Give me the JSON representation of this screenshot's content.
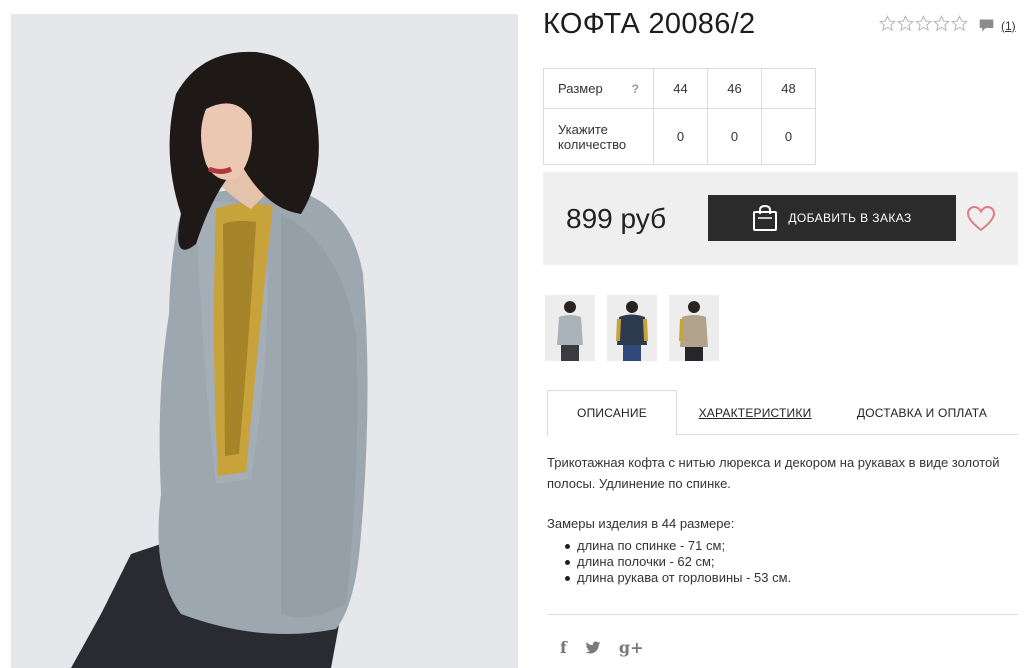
{
  "product": {
    "title": "КОФТА 20086/2",
    "rating_stars": 0,
    "review_count": "(1)"
  },
  "size_table": {
    "size_label": "Размер",
    "help": "?",
    "sizes": [
      "44",
      "46",
      "48"
    ],
    "qty_label": "Укажите количество",
    "quantities": [
      "0",
      "0",
      "0"
    ]
  },
  "purchase": {
    "price": "899 руб",
    "add_button": "ДОБАВИТЬ В ЗАКАЗ"
  },
  "thumbnails": [
    "grey-sweater",
    "navy-sweater",
    "beige-sweater"
  ],
  "tabs": {
    "description": "ОПИСАНИЕ",
    "specs": "ХАРАКТЕРИСТИКИ",
    "delivery": "ДОСТАВКА И ОПЛАТА"
  },
  "description": {
    "text": "Трикотажная кофта с нитью люрекса и декором на рукавах в виде золотой полосы. Удлинение по спинке.",
    "measure_title": "Замеры изделия в 44 размере:",
    "measures": [
      "длина по спинке - 71 см;",
      "длина полочки - 62 см;",
      "длина рукава от горловины - 53 см."
    ]
  },
  "social": {
    "facebook": "f",
    "twitter": "t",
    "google": "g+"
  },
  "colors": {
    "button": "#2b2b2b",
    "price_bg": "#efefef",
    "heart": "#e07a88",
    "sweater": "#9aa5ae",
    "sequin": "#c8a23a"
  }
}
